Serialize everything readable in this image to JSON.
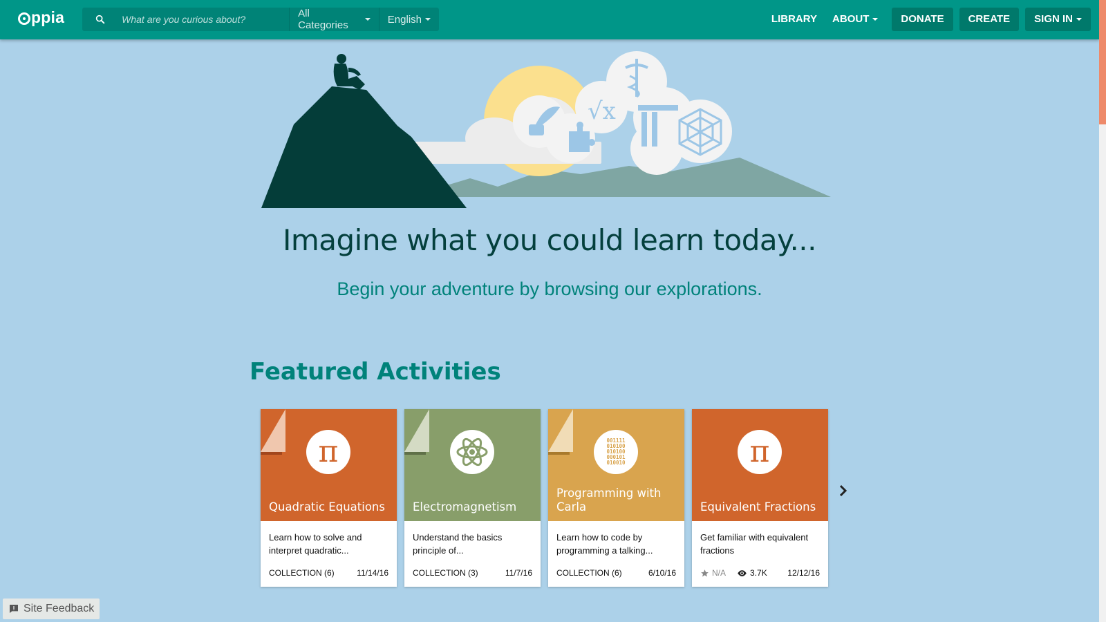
{
  "header": {
    "logo_text": "ppia",
    "search_placeholder": "What are you curious about?",
    "category_label": "All Categories",
    "language_label": "English",
    "nav": {
      "library": "LIBRARY",
      "about": "ABOUT",
      "donate": "DONATE",
      "create": "CREATE",
      "sign_in": "SIGN IN"
    }
  },
  "hero": {
    "title": "Imagine what you could learn today...",
    "subtitle": "Begin your adventure by browsing our explorations."
  },
  "featured": {
    "heading": "Featured Activities",
    "cards": [
      {
        "title": "Quadratic Equations",
        "description": "Learn how to solve and interpret quadratic...",
        "type_label": "COLLECTION (6)",
        "date": "11/14/16",
        "color": "#d0652c",
        "icon": "pi-icon"
      },
      {
        "title": "Electromagnetism",
        "description": "Understand the basics principle of...",
        "type_label": "COLLECTION (3)",
        "date": "11/7/16",
        "color": "#889e6a",
        "icon": "atom-icon"
      },
      {
        "title": "Programming with Carla",
        "description": "Learn how to code by programming a talking...",
        "type_label": "COLLECTION (6)",
        "date": "6/10/16",
        "color": "#d9a44e",
        "icon": "binary-icon"
      },
      {
        "title": "Equivalent Fractions",
        "description": "Get familiar with equivalent fractions",
        "rating": "N/A",
        "views": "3.7K",
        "date": "12/12/16",
        "color": "#d0652c",
        "icon": "pi-icon"
      }
    ]
  },
  "feedback": {
    "label": "Site Feedback"
  },
  "colors": {
    "topbar": "#009688",
    "background": "#acd1e9",
    "accent": "#00827a"
  }
}
